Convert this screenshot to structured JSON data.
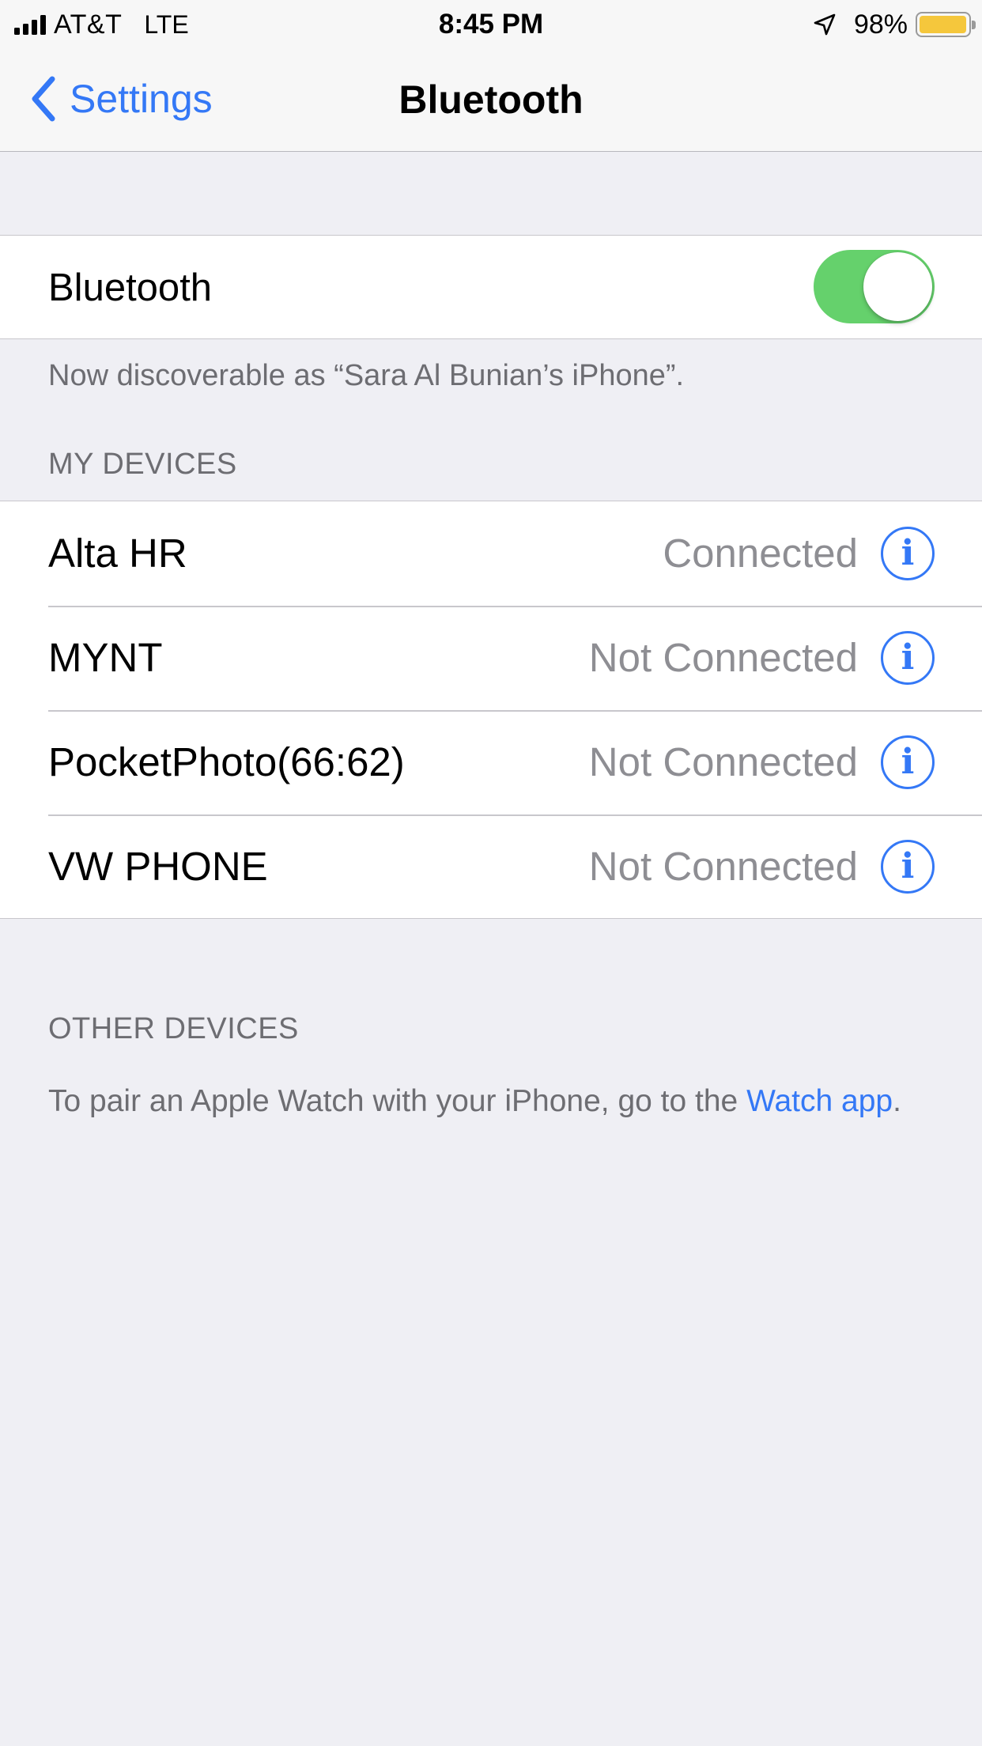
{
  "status_bar": {
    "carrier": "AT&T",
    "network": "LTE",
    "time": "8:45 PM",
    "battery_percent": "98%",
    "battery_level": 0.98,
    "signal_icon": "signal-bars-icon",
    "location_icon": "location-arrow-icon",
    "battery_color": "#f5c73c"
  },
  "nav": {
    "back_label": "Settings",
    "title": "Bluetooth",
    "accent_color": "#3478f6"
  },
  "bluetooth": {
    "label": "Bluetooth",
    "enabled": true,
    "toggle_color": "#65d16c",
    "discoverable_text": "Now discoverable as “Sara Al Bunian’s iPhone”."
  },
  "my_devices": {
    "header": "MY DEVICES",
    "items": [
      {
        "name": "Alta HR",
        "status": "Connected"
      },
      {
        "name": "MYNT",
        "status": "Not Connected"
      },
      {
        "name": "PocketPhoto(66:62)",
        "status": "Not Connected"
      },
      {
        "name": "VW PHONE",
        "status": "Not Connected"
      }
    ]
  },
  "other_devices": {
    "header": "OTHER DEVICES",
    "pair_text": "To pair an Apple Watch with your iPhone, go to the ",
    "link_text": "Watch app",
    "pair_suffix": "."
  }
}
